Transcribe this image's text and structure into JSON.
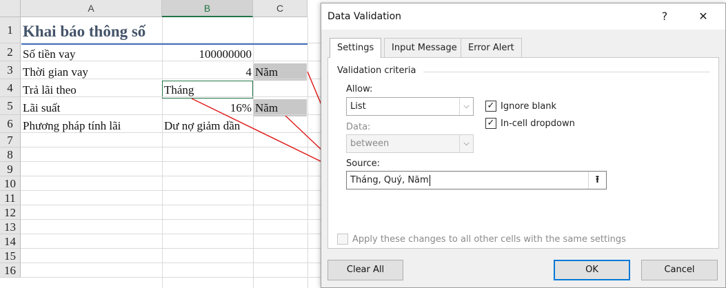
{
  "sheet": {
    "columns": [
      "A",
      "B",
      "C"
    ],
    "rows": [
      "1",
      "2",
      "3",
      "4",
      "5",
      "6",
      "7",
      "8",
      "9",
      "10",
      "11",
      "12",
      "13",
      "14",
      "15",
      "16"
    ],
    "title": "Khai báo thông số",
    "cells": {
      "a2": "Số tiền vay",
      "b2": "100000000",
      "a3": "Thời gian vay",
      "b3": "4",
      "c3": "Năm",
      "a4": "Trả lãi theo",
      "b4": "Tháng",
      "a5": "Lãi suất",
      "b5": "16%",
      "c5": "Năm",
      "a6": "Phương pháp tính lãi",
      "b6": "Dư nợ giảm dần"
    },
    "selected_column": "B",
    "accent_color": "#217346",
    "title_color": "#44546a",
    "arrow_color": "#e02020"
  },
  "dialog": {
    "title": "Data Validation",
    "help_icon": "?",
    "close_icon": "✕",
    "tabs": [
      "Settings",
      "Input Message",
      "Error Alert"
    ],
    "active_tab": "Settings",
    "group_label": "Validation criteria",
    "allow_label": "Allow:",
    "allow_value": "List",
    "data_label": "Data:",
    "data_value": "between",
    "ignore_blank_label": "Ignore blank",
    "ignore_blank_checked": true,
    "in_cell_dropdown_label": "In-cell dropdown",
    "in_cell_dropdown_checked": true,
    "source_label": "Source:",
    "source_value": "Tháng, Quý, Năm",
    "apply_all_label": "Apply these changes to all other cells with the same settings",
    "apply_all_checked": false,
    "clear_all_label": "Clear All",
    "ok_label": "OK",
    "cancel_label": "Cancel",
    "check_glyph": "✓",
    "dropdown_glyph": "⌵",
    "collapse_glyph": "⭱"
  }
}
